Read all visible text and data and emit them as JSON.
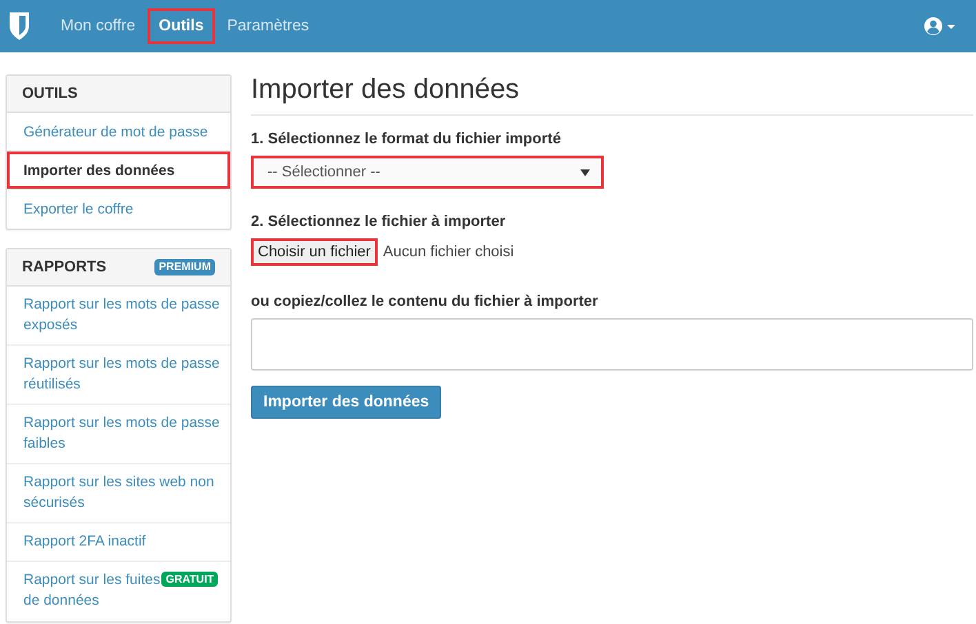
{
  "navbar": {
    "items": [
      {
        "label": "Mon coffre",
        "selected": false,
        "highlighted": false
      },
      {
        "label": "Outils",
        "selected": true,
        "highlighted": true
      },
      {
        "label": "Paramètres",
        "selected": false,
        "highlighted": false
      }
    ]
  },
  "sidebar": [
    {
      "title": "OUTILS",
      "items": [
        {
          "label": "Générateur de mot de passe",
          "selected": false,
          "highlighted": false
        },
        {
          "label": "Importer des données",
          "selected": true,
          "highlighted": true
        },
        {
          "label": "Exporter le coffre",
          "selected": false,
          "highlighted": false
        }
      ]
    },
    {
      "title": "RAPPORTS",
      "badge": {
        "text": "PREMIUM",
        "color": "#3c8dbc"
      },
      "items": [
        {
          "label": "Rapport sur les mots de passe exposés",
          "selected": false,
          "highlighted": false
        },
        {
          "label": "Rapport sur les mots de passe réutilisés",
          "selected": false,
          "highlighted": false
        },
        {
          "label": "Rapport sur les mots de passe faibles",
          "selected": false,
          "highlighted": false
        },
        {
          "label": "Rapport sur les sites web non sécurisés",
          "selected": false,
          "highlighted": false
        },
        {
          "label": "Rapport 2FA inactif",
          "selected": false,
          "highlighted": false
        },
        {
          "label": "Rapport sur les fuites",
          "selected": false,
          "highlighted": false,
          "badge": {
            "text": "GRATUIT",
            "color": "#00a65a"
          },
          "label_continued": "de données"
        }
      ]
    }
  ],
  "main": {
    "title": "Importer des données",
    "format_label": "1. Sélectionnez le format du fichier importé",
    "format_select": {
      "value": "-- Sélectionner --",
      "highlighted": true
    },
    "file_label": "2. Sélectionnez le fichier à importer",
    "file_button": {
      "label": "Choisir un fichier",
      "highlighted": true
    },
    "file_status": "Aucun fichier choisi",
    "paste_label": "ou copiez/collez le contenu du fichier à importer",
    "submit_button": "Importer des données"
  }
}
